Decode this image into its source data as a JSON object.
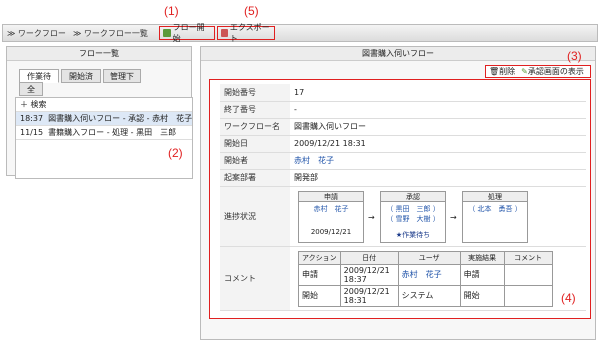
{
  "callouts": {
    "c1": "(1)",
    "c5": "(5)",
    "c3": "(3)",
    "c2": "(2)",
    "c4": "(4)"
  },
  "toolbar": {
    "crumb1": "ワークフロー",
    "crumb2": "ワークフロー一覧",
    "start": "フロー開始",
    "export": "エクスポート"
  },
  "left": {
    "title": "フロー一覧",
    "tabs": [
      "作業待ち",
      "開始済",
      "管理下",
      "全て"
    ],
    "search": "検索",
    "rows": [
      {
        "time": "18:37",
        "text": "図書購入伺いフロー - 承認 - 赤村　花子"
      },
      {
        "time": "11/15",
        "text": "書籍購入フロー - 処理 - 黒田　三郎"
      }
    ]
  },
  "right": {
    "title": "図書購入伺いフロー",
    "delete": "削除",
    "approve_view": "承認画面の表示",
    "fields": {
      "start_no_l": "開始番号",
      "start_no": "17",
      "end_no_l": "終了番号",
      "end_no": "-",
      "wf_name_l": "ワークフロー名",
      "wf_name": "図書購入伺いフロー",
      "start_date_l": "開始日",
      "start_date": "2009/12/21 18:31",
      "starter_l": "開始者",
      "starter": "赤村　花子",
      "dept_l": "起案部署",
      "dept": "開発部",
      "progress_l": "進捗状況",
      "comment_l": "コメント"
    },
    "progress": {
      "apply_h": "申請",
      "apply_name": "赤村　花子",
      "apply_date": "2009/12/21",
      "approve_h": "承認",
      "approve_a": "（ 黒田　三郎 ）",
      "approve_b": "（ 雪野　大樹 ）",
      "approve_status": "★作業待ち",
      "process_h": "処理",
      "process_a": "（ 北本　勇吾 ）",
      "arrow": "→"
    },
    "comments": {
      "headers": [
        "アクション",
        "日付",
        "ユーザ",
        "実施結果",
        "コメント"
      ],
      "rows": [
        [
          "申請",
          "2009/12/21 18:37",
          "赤村　花子",
          "申請",
          ""
        ],
        [
          "開始",
          "2009/12/21 18:31",
          "システム",
          "開始",
          ""
        ]
      ]
    }
  }
}
